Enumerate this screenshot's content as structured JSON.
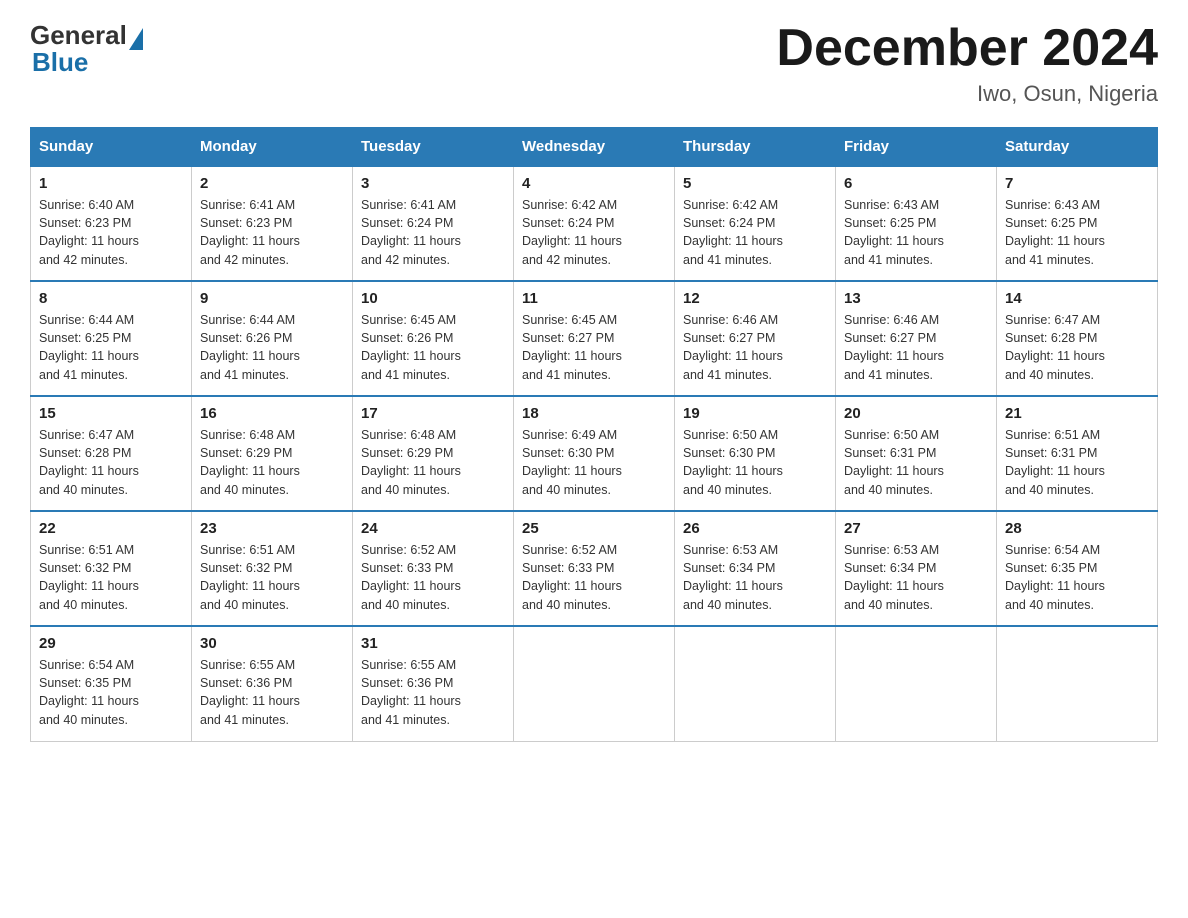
{
  "header": {
    "logo_general": "General",
    "logo_blue": "Blue",
    "title": "December 2024",
    "subtitle": "Iwo, Osun, Nigeria"
  },
  "days_of_week": [
    "Sunday",
    "Monday",
    "Tuesday",
    "Wednesday",
    "Thursday",
    "Friday",
    "Saturday"
  ],
  "weeks": [
    [
      {
        "day": "1",
        "sunrise": "6:40 AM",
        "sunset": "6:23 PM",
        "daylight": "11 hours and 42 minutes."
      },
      {
        "day": "2",
        "sunrise": "6:41 AM",
        "sunset": "6:23 PM",
        "daylight": "11 hours and 42 minutes."
      },
      {
        "day": "3",
        "sunrise": "6:41 AM",
        "sunset": "6:24 PM",
        "daylight": "11 hours and 42 minutes."
      },
      {
        "day": "4",
        "sunrise": "6:42 AM",
        "sunset": "6:24 PM",
        "daylight": "11 hours and 42 minutes."
      },
      {
        "day": "5",
        "sunrise": "6:42 AM",
        "sunset": "6:24 PM",
        "daylight": "11 hours and 41 minutes."
      },
      {
        "day": "6",
        "sunrise": "6:43 AM",
        "sunset": "6:25 PM",
        "daylight": "11 hours and 41 minutes."
      },
      {
        "day": "7",
        "sunrise": "6:43 AM",
        "sunset": "6:25 PM",
        "daylight": "11 hours and 41 minutes."
      }
    ],
    [
      {
        "day": "8",
        "sunrise": "6:44 AM",
        "sunset": "6:25 PM",
        "daylight": "11 hours and 41 minutes."
      },
      {
        "day": "9",
        "sunrise": "6:44 AM",
        "sunset": "6:26 PM",
        "daylight": "11 hours and 41 minutes."
      },
      {
        "day": "10",
        "sunrise": "6:45 AM",
        "sunset": "6:26 PM",
        "daylight": "11 hours and 41 minutes."
      },
      {
        "day": "11",
        "sunrise": "6:45 AM",
        "sunset": "6:27 PM",
        "daylight": "11 hours and 41 minutes."
      },
      {
        "day": "12",
        "sunrise": "6:46 AM",
        "sunset": "6:27 PM",
        "daylight": "11 hours and 41 minutes."
      },
      {
        "day": "13",
        "sunrise": "6:46 AM",
        "sunset": "6:27 PM",
        "daylight": "11 hours and 41 minutes."
      },
      {
        "day": "14",
        "sunrise": "6:47 AM",
        "sunset": "6:28 PM",
        "daylight": "11 hours and 40 minutes."
      }
    ],
    [
      {
        "day": "15",
        "sunrise": "6:47 AM",
        "sunset": "6:28 PM",
        "daylight": "11 hours and 40 minutes."
      },
      {
        "day": "16",
        "sunrise": "6:48 AM",
        "sunset": "6:29 PM",
        "daylight": "11 hours and 40 minutes."
      },
      {
        "day": "17",
        "sunrise": "6:48 AM",
        "sunset": "6:29 PM",
        "daylight": "11 hours and 40 minutes."
      },
      {
        "day": "18",
        "sunrise": "6:49 AM",
        "sunset": "6:30 PM",
        "daylight": "11 hours and 40 minutes."
      },
      {
        "day": "19",
        "sunrise": "6:50 AM",
        "sunset": "6:30 PM",
        "daylight": "11 hours and 40 minutes."
      },
      {
        "day": "20",
        "sunrise": "6:50 AM",
        "sunset": "6:31 PM",
        "daylight": "11 hours and 40 minutes."
      },
      {
        "day": "21",
        "sunrise": "6:51 AM",
        "sunset": "6:31 PM",
        "daylight": "11 hours and 40 minutes."
      }
    ],
    [
      {
        "day": "22",
        "sunrise": "6:51 AM",
        "sunset": "6:32 PM",
        "daylight": "11 hours and 40 minutes."
      },
      {
        "day": "23",
        "sunrise": "6:51 AM",
        "sunset": "6:32 PM",
        "daylight": "11 hours and 40 minutes."
      },
      {
        "day": "24",
        "sunrise": "6:52 AM",
        "sunset": "6:33 PM",
        "daylight": "11 hours and 40 minutes."
      },
      {
        "day": "25",
        "sunrise": "6:52 AM",
        "sunset": "6:33 PM",
        "daylight": "11 hours and 40 minutes."
      },
      {
        "day": "26",
        "sunrise": "6:53 AM",
        "sunset": "6:34 PM",
        "daylight": "11 hours and 40 minutes."
      },
      {
        "day": "27",
        "sunrise": "6:53 AM",
        "sunset": "6:34 PM",
        "daylight": "11 hours and 40 minutes."
      },
      {
        "day": "28",
        "sunrise": "6:54 AM",
        "sunset": "6:35 PM",
        "daylight": "11 hours and 40 minutes."
      }
    ],
    [
      {
        "day": "29",
        "sunrise": "6:54 AM",
        "sunset": "6:35 PM",
        "daylight": "11 hours and 40 minutes."
      },
      {
        "day": "30",
        "sunrise": "6:55 AM",
        "sunset": "6:36 PM",
        "daylight": "11 hours and 41 minutes."
      },
      {
        "day": "31",
        "sunrise": "6:55 AM",
        "sunset": "6:36 PM",
        "daylight": "11 hours and 41 minutes."
      },
      null,
      null,
      null,
      null
    ]
  ],
  "labels": {
    "sunrise": "Sunrise:",
    "sunset": "Sunset:",
    "daylight": "Daylight:"
  }
}
